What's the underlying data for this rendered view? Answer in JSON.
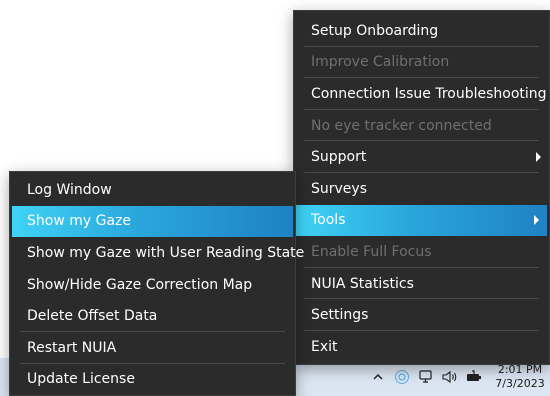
{
  "main_menu": {
    "items": [
      {
        "label": "Setup Onboarding",
        "disabled": false
      },
      {
        "label": "Improve Calibration",
        "disabled": true
      },
      {
        "label": "Connection Issue Troubleshooting",
        "disabled": false
      },
      {
        "label": "No eye tracker connected",
        "disabled": true
      },
      {
        "label": "Support",
        "disabled": false,
        "submenu": true
      },
      {
        "label": "Surveys",
        "disabled": false
      },
      {
        "label": "Tools",
        "disabled": false,
        "submenu": true,
        "highlighted": true
      },
      {
        "label": "Enable Full Focus",
        "disabled": true
      },
      {
        "label": "NUIA Statistics",
        "disabled": false
      },
      {
        "label": "Settings",
        "disabled": false
      },
      {
        "label": "Exit",
        "disabled": false
      }
    ]
  },
  "tools_menu": {
    "items": [
      {
        "label": "Log Window"
      },
      {
        "label": "Show my Gaze",
        "highlighted": true
      },
      {
        "label": "Show my Gaze with User Reading State"
      },
      {
        "label": "Show/Hide Gaze Correction Map"
      },
      {
        "label": "Delete Offset Data"
      },
      {
        "label": "Restart NUIA"
      },
      {
        "label": "Update License"
      }
    ]
  },
  "taskbar": {
    "time": "2:01 PM",
    "date": "7/3/2023",
    "icons": [
      "chevron-up-icon",
      "nuia-tray-icon",
      "network-icon",
      "volume-icon",
      "battery-icon"
    ]
  },
  "colors": {
    "menu_bg": "#2b2b2b",
    "highlight_start": "#3fd3f5",
    "highlight_end": "#1e82c3",
    "disabled_text": "#6f6f6f",
    "taskbar_bg": "#dce6f3"
  }
}
